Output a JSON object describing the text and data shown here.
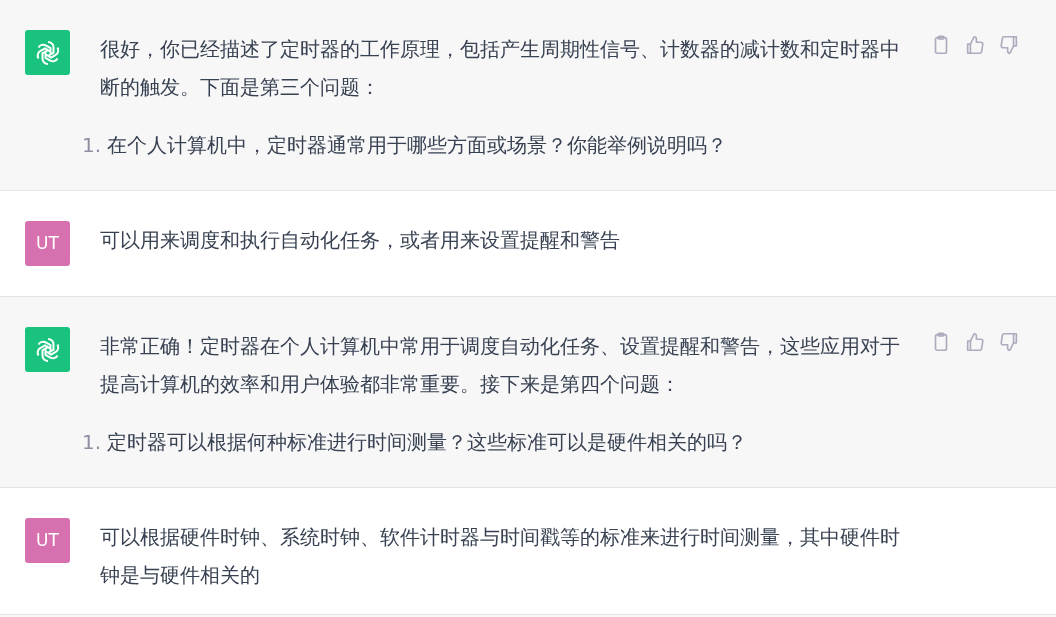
{
  "messages": [
    {
      "kind": "assistant",
      "paragraphs": [
        "很好，你已经描述了定时器的工作原理，包括产生周期性信号、计数器的减计数和定时器中断的触发。下面是第三个问题："
      ],
      "list": [
        {
          "marker": "1.",
          "text": "在个人计算机中，定时器通常用于哪些方面或场景？你能举例说明吗？"
        }
      ]
    },
    {
      "kind": "user",
      "avatar": "UT",
      "paragraphs": [
        "可以用来调度和执行自动化任务，或者用来设置提醒和警告"
      ]
    },
    {
      "kind": "assistant",
      "paragraphs": [
        "非常正确！定时器在个人计算机中常用于调度自动化任务、设置提醒和警告，这些应用对于提高计算机的效率和用户体验都非常重要。接下来是第四个问题："
      ],
      "list": [
        {
          "marker": "1.",
          "text": "定时器可以根据何种标准进行时间测量？这些标准可以是硬件相关的吗？"
        }
      ]
    },
    {
      "kind": "user",
      "avatar": "UT",
      "paragraphs": [
        "可以根据硬件时钟、系统时钟、软件计时器与时间戳等的标准来进行时间测量，其中硬件时钟是与硬件相关的"
      ]
    }
  ]
}
